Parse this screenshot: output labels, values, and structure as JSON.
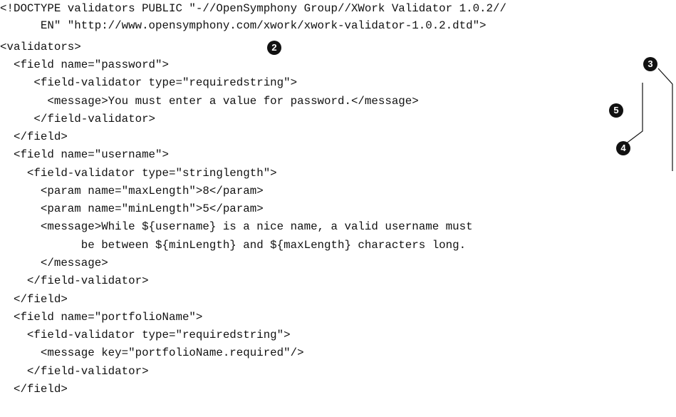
{
  "code_lines": [
    "<!DOCTYPE validators PUBLIC \"-//OpenSymphony Group//XWork Validator 1.0.2//",
    "      EN\" \"http://www.opensymphony.com/xwork/xwork-validator-1.0.2.dtd\">",
    "<validators>",
    "  <field name=\"password\">",
    "     <field-validator type=\"requiredstring\">",
    "       <message>You must enter a value for password.</message>",
    "     </field-validator>",
    "  </field>",
    "  <field name=\"username\">",
    "    <field-validator type=\"stringlength\">",
    "      <param name=\"maxLength\">8</param>",
    "      <param name=\"minLength\">5</param>",
    "      <message>While ${username} is a nice name, a valid username must",
    "            be between ${minLength} and ${maxLength} characters long.",
    "      </message>",
    "    </field-validator>",
    "  </field>",
    "  <field name=\"portfolioName\">",
    "    <field-validator type=\"requiredstring\">",
    "      <message key=\"portfolioName.required\"/>",
    "    </field-validator>",
    "  </field>"
  ],
  "callouts": {
    "c2": "2",
    "c3": "3",
    "c4": "4",
    "c5": "5"
  }
}
